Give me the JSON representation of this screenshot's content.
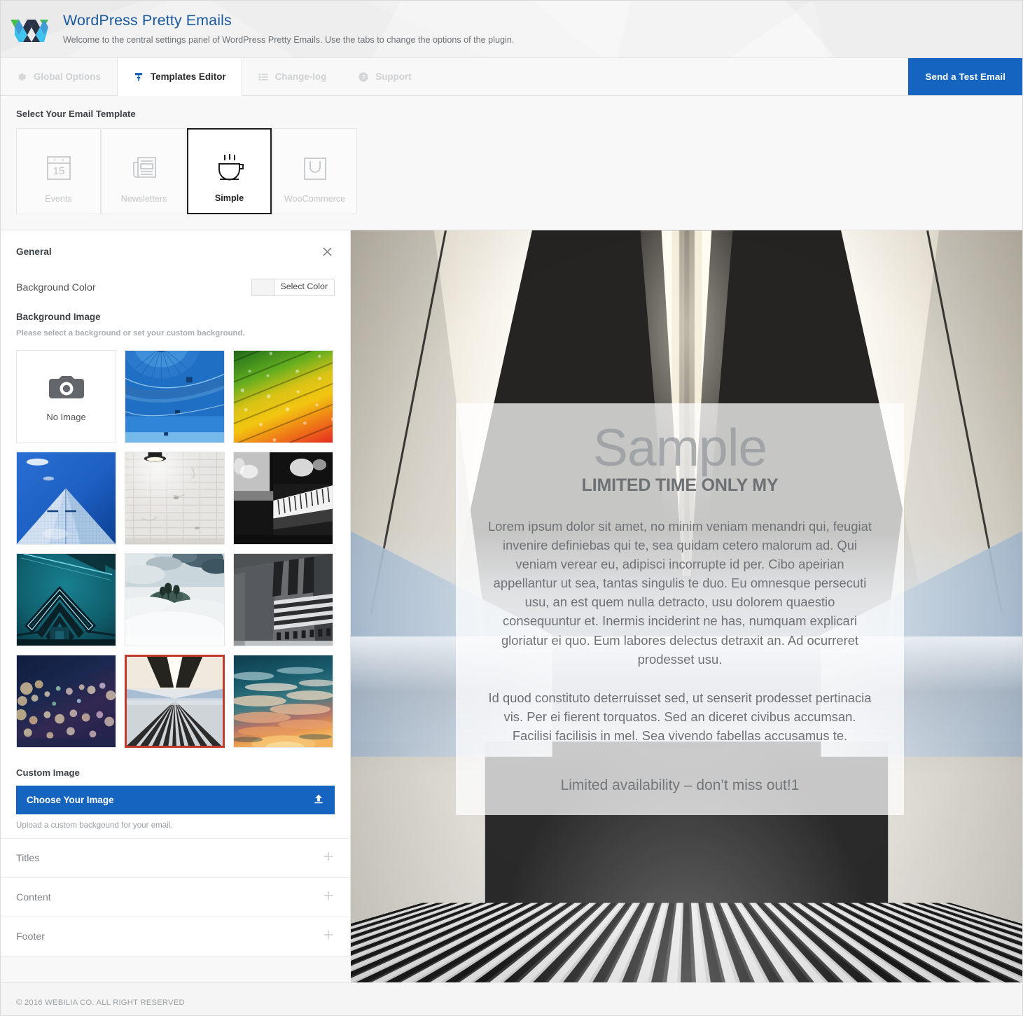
{
  "header": {
    "logo_icon": "webilia-w-logo",
    "title": "WordPress Pretty Emails",
    "subtitle": "Welcome to the central settings panel of WordPress Pretty Emails. Use the tabs to change the options of the plugin."
  },
  "tabs": [
    {
      "label": "Global Options",
      "icon": "gear-icon",
      "active": false
    },
    {
      "label": "Templates Editor",
      "icon": "paint-roller-icon",
      "active": true
    },
    {
      "label": "Change-log",
      "icon": "list-icon",
      "active": false
    },
    {
      "label": "Support",
      "icon": "question-circle-icon",
      "active": false
    }
  ],
  "test_email_button": {
    "label": "Send a Test Email"
  },
  "template_picker": {
    "title": "Select Your Email Template",
    "cards": [
      {
        "label": "Events",
        "icon": "calendar-15-icon",
        "selected": false
      },
      {
        "label": "Newsletters",
        "icon": "newspaper-icon",
        "selected": false
      },
      {
        "label": "Simple",
        "icon": "coffee-cup-icon",
        "selected": true
      },
      {
        "label": "WooCommerce",
        "icon": "shopping-bag-icon",
        "selected": false
      }
    ]
  },
  "panel": {
    "title": "General",
    "close_icon": "close-icon",
    "background_color": {
      "label": "Background Color",
      "button_label": "Select Color",
      "swatch_color": "#f4f4f4"
    },
    "background_image": {
      "title": "Background Image",
      "description": "Please select a background or set your custom background.",
      "thumbnails": [
        {
          "name": "No Image",
          "icon": "camera-icon",
          "selected": false,
          "kind": "none"
        },
        {
          "name": "Blue hot air balloon",
          "selected": false,
          "kind": "balloon"
        },
        {
          "name": "Colorful rainbow rods with water drops",
          "selected": false,
          "kind": "rainbow"
        },
        {
          "name": "Glass skyscraper against blue sky",
          "selected": false,
          "kind": "skyscraper"
        },
        {
          "name": "White painted brick wall with lamp",
          "selected": false,
          "kind": "brickwall"
        },
        {
          "name": "Black and white piano keys",
          "selected": false,
          "kind": "piano"
        },
        {
          "name": "Teal geometric bridge tunnel",
          "selected": false,
          "kind": "bridge"
        },
        {
          "name": "Hill with trees above the clouds",
          "selected": false,
          "kind": "clouds"
        },
        {
          "name": "Black and white office tower",
          "selected": false,
          "kind": "tower"
        },
        {
          "name": "Blurred city bokeh night lights",
          "selected": false,
          "kind": "bokeh"
        },
        {
          "name": "Subway tunnel with striped floor",
          "selected": true,
          "kind": "tunnel"
        },
        {
          "name": "Sunset clouds over teal sky",
          "selected": false,
          "kind": "sunset"
        }
      ]
    },
    "custom_image": {
      "title": "Custom Image",
      "button_label": "Choose Your Image",
      "button_icon": "upload-icon",
      "description": "Upload a custom backgound for your email."
    },
    "accordion": [
      {
        "label": "Titles",
        "icon": "plus-icon"
      },
      {
        "label": "Content",
        "icon": "plus-icon"
      },
      {
        "label": "Footer",
        "icon": "plus-icon"
      }
    ]
  },
  "preview": {
    "heading": "Sample",
    "subheading": "LIMITED TIME ONLY MY",
    "paragraph_1": "Lorem ipsum dolor sit amet, no minim veniam menandri qui, feugiat invenire definiebas qui te, sea quidam cetero malorum ad. Qui veniam verear eu, adipisci incorrupte id per. Cibo apeirian appellantur ut sea, tantas singulis te duo. Eu omnesque persecuti usu, an est quem nulla detracto, usu dolorem quaestio consequuntur et. Inermis inciderint ne has, numquam explicari gloriatur ei quo. Eum labores delectus detraxit an. Ad ocurreret prodesset usu.",
    "paragraph_2": "Id quod constituto deterruisset sed, ut senserit prodesset pertinacia vis. Per ei fierent torquatos. Sed an diceret civibus accumsan. Facilisi facilisis in mel. Sea vivendo fabellas accusamus te.",
    "footer_line": "Limited availability – don’t miss out!1"
  },
  "footer": {
    "copyright": "© 2016 WEBILIA CO. ALL RIGHT RESERVED"
  },
  "colors": {
    "brand_blue": "#1565c0",
    "title_blue": "#1b5a9e",
    "selected_thumb_border": "#c0392b",
    "muted_text": "#9aa0a4"
  }
}
